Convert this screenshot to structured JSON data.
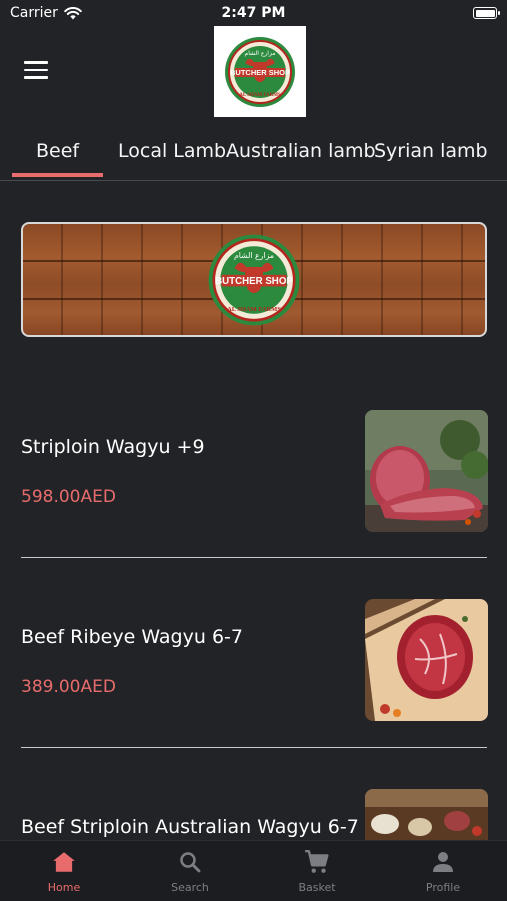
{
  "status_bar": {
    "carrier": "Carrier",
    "time": "2:47 PM"
  },
  "header": {
    "logo": {
      "arabic": "مزارع الشام",
      "title": "BUTCHER SHOP",
      "subtitle": "AL SHAM FARMS"
    }
  },
  "tabs": [
    {
      "label": "Beef",
      "active": true
    },
    {
      "label": "Local Lamb",
      "active": false
    },
    {
      "label": "Australian lamb",
      "active": false
    },
    {
      "label": "Syrian lamb",
      "active": false
    }
  ],
  "banner": {
    "logo": {
      "arabic": "مزارع الشام",
      "title": "BUTCHER SHOP",
      "subtitle": "AL SHAM FARMS"
    }
  },
  "products": [
    {
      "name": "Striploin Wagyu +9",
      "price": "598.00AED"
    },
    {
      "name": "Beef Ribeye Wagyu 6-7",
      "price": "389.00AED"
    },
    {
      "name": "Beef Striploin Australian Wagyu 6-7",
      "price": ""
    }
  ],
  "bottom_nav": [
    {
      "label": "Home",
      "icon": "home-icon",
      "active": true
    },
    {
      "label": "Search",
      "icon": "search-icon",
      "active": false
    },
    {
      "label": "Basket",
      "icon": "cart-icon",
      "active": false
    },
    {
      "label": "Profile",
      "icon": "profile-icon",
      "active": false
    }
  ],
  "colors": {
    "background": "#222327",
    "accent": "#e86c6c",
    "nav_background": "#1c1d20"
  }
}
